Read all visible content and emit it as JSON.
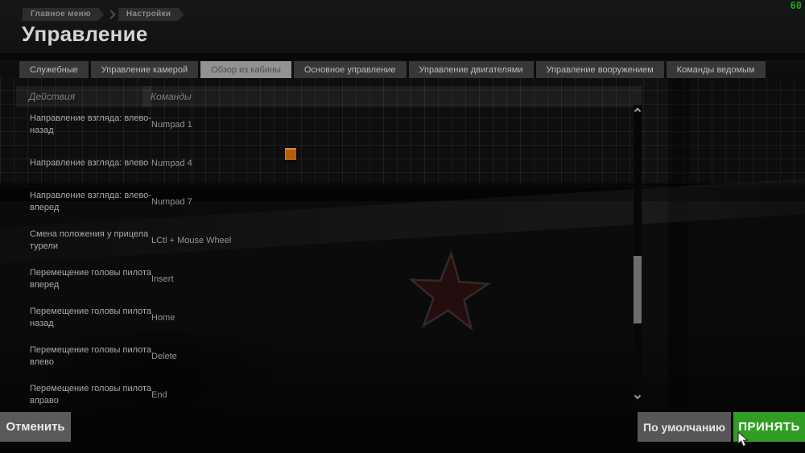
{
  "fps_counter": "60",
  "breadcrumb": {
    "items": [
      {
        "label": "Главное меню"
      },
      {
        "label": "Настройки"
      }
    ]
  },
  "title": "Управление",
  "tabs": [
    {
      "label": "Служебные",
      "selected": false
    },
    {
      "label": "Управление камерой",
      "selected": false
    },
    {
      "label": "Обзор из кабины",
      "selected": true
    },
    {
      "label": "Основное управление",
      "selected": false
    },
    {
      "label": "Управление двигателями",
      "selected": false
    },
    {
      "label": "Управление вооружением",
      "selected": false
    },
    {
      "label": "Команды ведомым",
      "selected": false
    }
  ],
  "columns": {
    "actions": "Действия",
    "commands": "Команды"
  },
  "bindings": [
    {
      "action": "Направление взгляда: влево-назад",
      "command": "Numpad 1"
    },
    {
      "action": "Направление взгляда: влево",
      "command": "Numpad 4"
    },
    {
      "action": "Направление взгляда: влево-вперед",
      "command": "Numpad 7"
    },
    {
      "action": "Смена положения у прицела турели",
      "command": "LCtl + Mouse Wheel"
    },
    {
      "action": "Перемещение головы пилота вперед",
      "command": "Insert"
    },
    {
      "action": "Перемещение головы пилота назад",
      "command": "Home"
    },
    {
      "action": "Перемещение головы пилота влево",
      "command": "Delete"
    },
    {
      "action": "Перемещение головы пилота вправо",
      "command": "End"
    }
  ],
  "buttons": {
    "cancel": "Отменить",
    "defaults": "По умолчанию",
    "accept": "ПРИНЯТЬ"
  },
  "colors": {
    "accent_green": "#2f9e22",
    "fps_green": "#1ca21c",
    "selected_tab_bg": "#929292",
    "star_red": "#351010"
  }
}
